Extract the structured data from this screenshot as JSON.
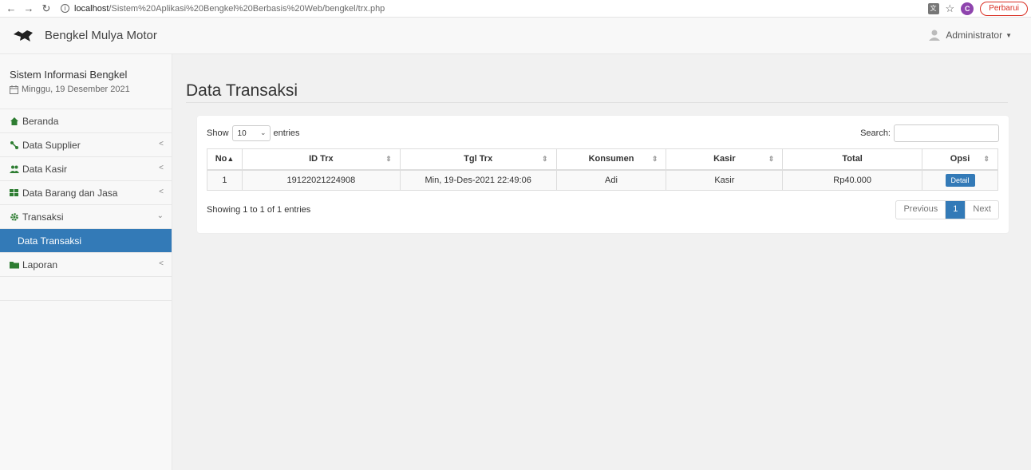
{
  "browser": {
    "url_host": "localhost",
    "url_path": "/Sistem%20Aplikasi%20Bengkel%20Berbasis%20Web/bengkel/trx.php",
    "profile_initial": "C",
    "update_label": "Perbarui"
  },
  "header": {
    "brand": "Bengkel Mulya Motor",
    "user": "Administrator"
  },
  "sidebar": {
    "title": "Sistem Informasi Bengkel",
    "date": "Minggu, 19 Desember 2021",
    "items": [
      {
        "label": "Beranda"
      },
      {
        "label": "Data Supplier"
      },
      {
        "label": "Data Kasir"
      },
      {
        "label": "Data Barang dan Jasa"
      },
      {
        "label": "Transaksi"
      },
      {
        "label": "Data Transaksi"
      },
      {
        "label": "Laporan"
      }
    ]
  },
  "main": {
    "title": "Data Transaksi",
    "show_label": "Show",
    "entries_value": "10",
    "entries_label": "entries",
    "search_label": "Search:",
    "columns": [
      "No",
      "ID Trx",
      "Tgl Trx",
      "Konsumen",
      "Kasir",
      "Total",
      "Opsi"
    ],
    "rows": [
      {
        "no": "1",
        "id": "19122021224908",
        "tgl": "Min, 19-Des-2021 22:49:06",
        "konsumen": "Adi",
        "kasir": "Kasir",
        "total": "Rp40.000",
        "opsi": "Detail"
      }
    ],
    "info": "Showing 1 to 1 of 1 entries",
    "pager": {
      "previous": "Previous",
      "page": "1",
      "next": "Next"
    }
  },
  "colors": {
    "accent": "#337ab7",
    "update": "#d93025"
  }
}
